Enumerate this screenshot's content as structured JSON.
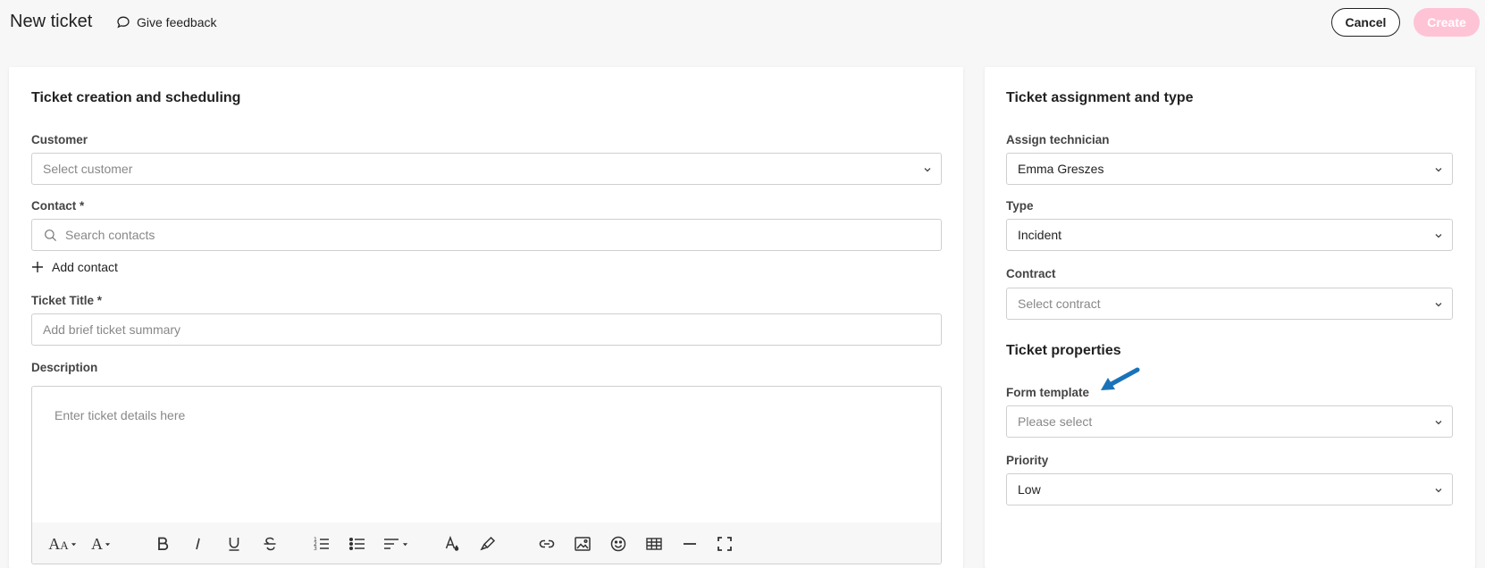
{
  "header": {
    "title": "New ticket",
    "feedback_label": "Give feedback",
    "cancel_label": "Cancel",
    "create_label": "Create"
  },
  "left_card": {
    "title": "Ticket creation and scheduling",
    "customer": {
      "label": "Customer",
      "placeholder": "Select customer"
    },
    "contact": {
      "label": "Contact *",
      "placeholder": "Search contacts",
      "add_label": "Add contact"
    },
    "ticket_title": {
      "label": "Ticket Title *",
      "placeholder": "Add brief ticket summary"
    },
    "description": {
      "label": "Description",
      "placeholder": "Enter ticket details here"
    },
    "toolbar": {
      "font_size_icon": "text-size-icon",
      "font_family_icon": "font-icon",
      "bold_icon": "bold-icon",
      "italic_icon": "italic-icon",
      "underline_icon": "underline-icon",
      "strike_icon": "strikethrough-icon",
      "ordered_list_icon": "ordered-list-icon",
      "bullet_list_icon": "bullet-list-icon",
      "align_icon": "align-icon",
      "text_color_icon": "text-color-icon",
      "highlight_icon": "highlighter-icon",
      "link_icon": "link-icon",
      "image_icon": "image-icon",
      "emoji_icon": "emoji-icon",
      "table_icon": "table-icon",
      "hr_icon": "horizontal-line-icon",
      "fullscreen_icon": "fullscreen-icon"
    }
  },
  "right_card": {
    "title": "Ticket assignment and type",
    "technician": {
      "label": "Assign technician",
      "value": "Emma Greszes"
    },
    "type": {
      "label": "Type",
      "value": "Incident"
    },
    "contract": {
      "label": "Contract",
      "placeholder": "Select contract"
    },
    "properties_title": "Ticket properties",
    "form_template": {
      "label": "Form template",
      "placeholder": "Please select"
    },
    "priority": {
      "label": "Priority",
      "value": "Low"
    }
  },
  "colors": {
    "create_button": "#ffc3d6",
    "annotation_arrow": "#1a73b8"
  }
}
